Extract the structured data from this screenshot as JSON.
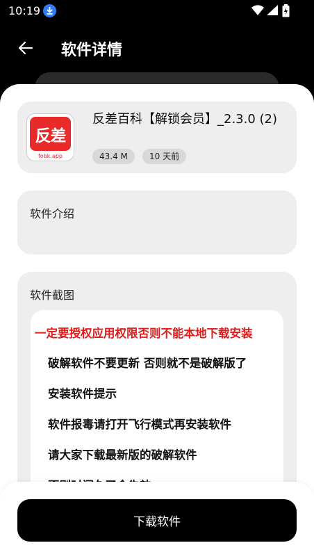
{
  "status_bar": {
    "time": "10:19"
  },
  "app_bar": {
    "title": "软件详情"
  },
  "app": {
    "name": "反差百科【解锁会员】_2.3.0 (2)",
    "icon_text": "反差",
    "icon_domain": "fobk.app",
    "size": "43.4 M",
    "age": "10 天前"
  },
  "intro": {
    "label": "软件介绍"
  },
  "screenshots": {
    "label": "软件截图",
    "warning": "一定要授权应用权限否则不能本地下载安装",
    "lines": [
      "破解软件不要更新 否则就不是破解版了",
      "安装软件提示",
      "软件报毒请打开飞行模式再安装软件",
      "请大家下载最新版的破解软件",
      "否则时间久了会失效"
    ]
  },
  "download": {
    "label": "下载软件"
  },
  "colors": {
    "accent_red": "#e01b1b",
    "download_blue": "#2f7cf6"
  }
}
